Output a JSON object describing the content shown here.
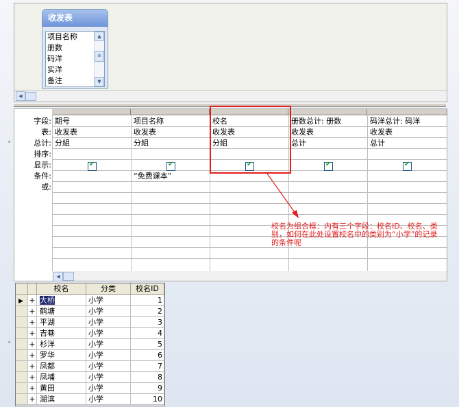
{
  "table_box": {
    "title": "收发表",
    "fields": [
      "项目名称",
      "册数",
      "码洋",
      "实洋",
      "备注"
    ]
  },
  "grid": {
    "row_labels": [
      "字段:",
      "表:",
      "总计:",
      "排序:",
      "显示:",
      "条件:",
      "或:"
    ],
    "columns": [
      {
        "field": "期号",
        "table": "收发表",
        "total": "分組",
        "sort": "",
        "show": true,
        "criteria": ""
      },
      {
        "field": "项目名称",
        "table": "收发表",
        "total": "分組",
        "sort": "",
        "show": true,
        "criteria": "“免费课本”"
      },
      {
        "field": "校名",
        "table": "收发表",
        "total": "分組",
        "sort": "",
        "show": true,
        "criteria": ""
      },
      {
        "field": "册数总计: 册数",
        "table": "收发表",
        "total": "总计",
        "sort": "",
        "show": true,
        "criteria": ""
      },
      {
        "field": "码洋总计: 码洋",
        "table": "收发表",
        "total": "总计",
        "sort": "",
        "show": true,
        "criteria": ""
      }
    ]
  },
  "annotation": {
    "text": "校名为组合框：内有三个字段：校名ID、校名、类别，如何在此处设置校名中的类别为“小学”的记录的条件呢",
    "color": "#e21b1b"
  },
  "datasheet": {
    "headers": [
      "校名",
      "分类",
      "校名ID"
    ],
    "rows": [
      {
        "name": "大桥",
        "category": "小学",
        "id": "1"
      },
      {
        "name": "鹤塘",
        "category": "小学",
        "id": "2"
      },
      {
        "name": "平湖",
        "category": "小学",
        "id": "3"
      },
      {
        "name": "吉巷",
        "category": "小学",
        "id": "4"
      },
      {
        "name": "杉洋",
        "category": "小学",
        "id": "5"
      },
      {
        "name": "罗华",
        "category": "小学",
        "id": "6"
      },
      {
        "name": "凤都",
        "category": "小学",
        "id": "7"
      },
      {
        "name": "凤埔",
        "category": "小学",
        "id": "8"
      },
      {
        "name": "黄田",
        "category": "小学",
        "id": "9"
      },
      {
        "name": "湖滨",
        "category": "小学",
        "id": "10"
      }
    ],
    "expand_symbol": "+"
  },
  "icons": {
    "record_selector": "record-pointer-icon",
    "checkbox": "checkmark-icon"
  }
}
